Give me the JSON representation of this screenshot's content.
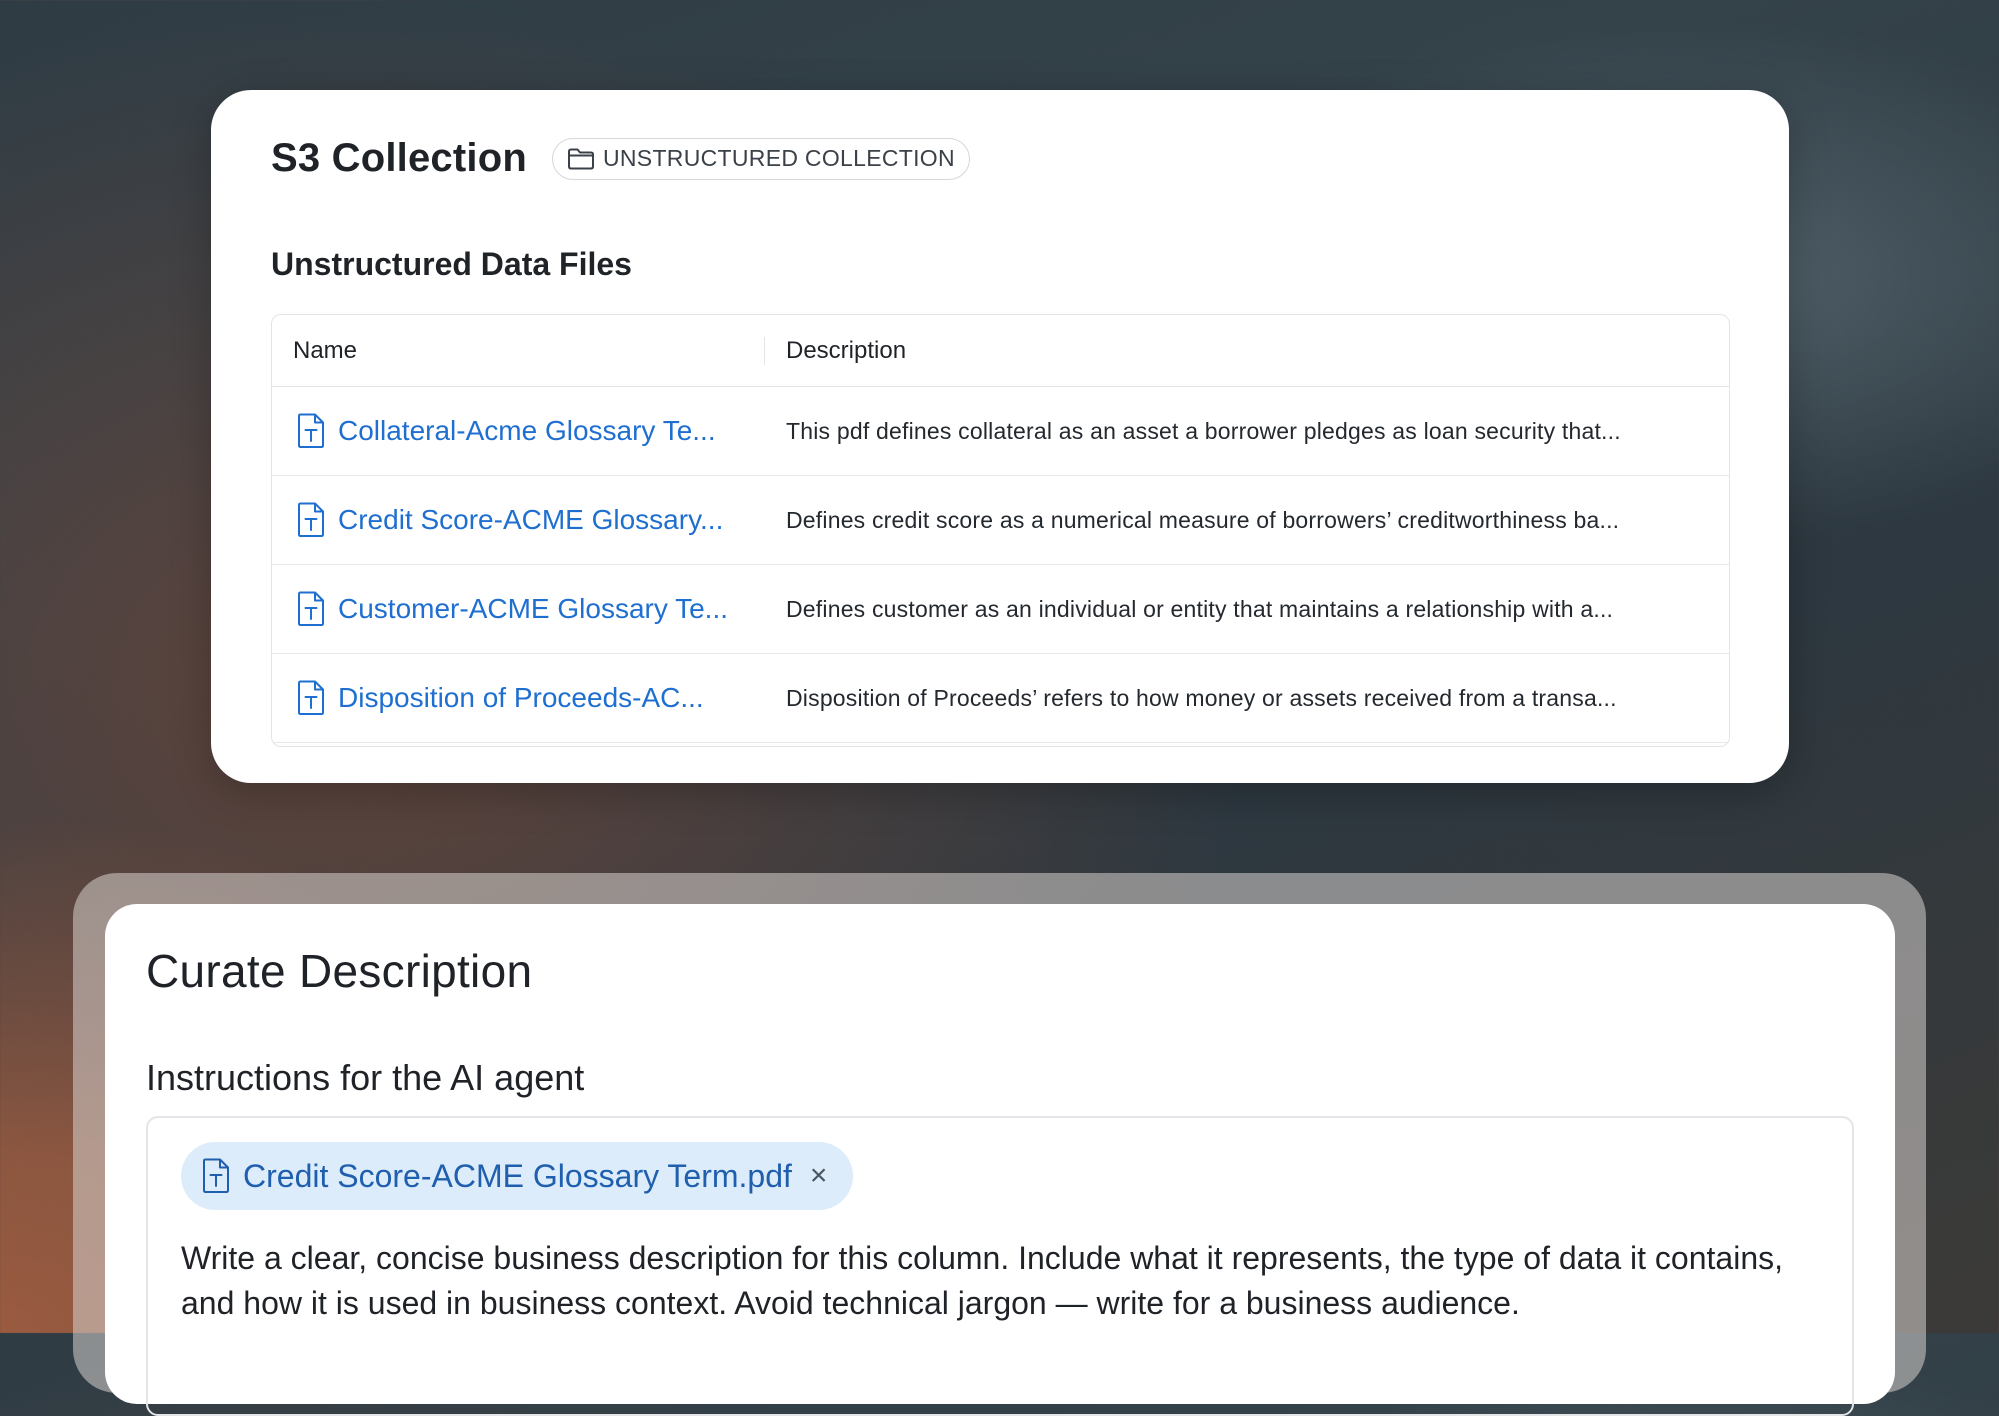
{
  "collection": {
    "title": "S3 Collection",
    "badge": {
      "icon": "folder-icon",
      "label": "UNSTRUCTURED COLLECTION"
    },
    "section_title": "Unstructured Data Files",
    "table": {
      "columns": [
        "Name",
        "Description"
      ],
      "rows": [
        {
          "icon": "text-file-icon",
          "name": "Collateral-Acme Glossary Te...",
          "description": "This pdf defines collateral as an asset a borrower pledges as loan security that..."
        },
        {
          "icon": "text-file-icon",
          "name": "Credit Score-ACME Glossary...",
          "description": "Defines credit score as a numerical measure of borrowers’ creditworthiness ba..."
        },
        {
          "icon": "text-file-icon",
          "name": "Customer-ACME Glossary Te...",
          "description": "Defines customer as an individual or entity that maintains a relationship with a..."
        },
        {
          "icon": "text-file-icon",
          "name": "Disposition of Proceeds-AC...",
          "description": "Disposition of Proceeds’ refers to how money or assets received from a transa..."
        }
      ]
    }
  },
  "curate": {
    "title": "Curate Description",
    "instructions_label": "Instructions for the AI agent",
    "attachment": {
      "icon": "text-file-icon",
      "label": "Credit Score-ACME Glossary Term.pdf",
      "remove": "×"
    },
    "instructions_text": "Write a clear, concise business description for this column. Include what it represents, the type of data it contains, and how it is used in business context. Avoid technical jargon — write for a business audience."
  },
  "colors": {
    "link": "#1f6fd1",
    "chip_background": "#dcecfb",
    "chip_text": "#1f5fae"
  }
}
